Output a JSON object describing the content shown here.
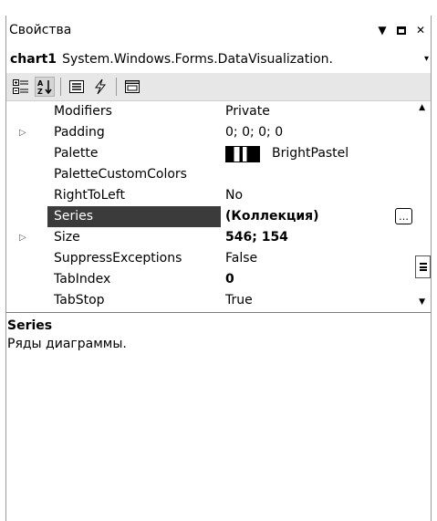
{
  "window": {
    "title": "Свойства",
    "controls": {
      "dropdown": "▼",
      "close": "✕"
    }
  },
  "selector": {
    "object_name": "chart1",
    "object_type": "System.Windows.Forms.DataVisualization.",
    "dropdown_glyph": "▾"
  },
  "toolbar": {
    "buttons": [
      {
        "name": "categorized-icon"
      },
      {
        "name": "alphabetical-icon"
      },
      {
        "name": "properties-icon"
      },
      {
        "name": "events-icon"
      },
      {
        "name": "property-pages-icon"
      }
    ]
  },
  "grid": {
    "rows": [
      {
        "name": "Modifiers",
        "value": "Private",
        "expander": ""
      },
      {
        "name": "Padding",
        "value": "0; 0; 0; 0",
        "expander": "▷"
      },
      {
        "name": "Palette",
        "value": "BrightPastel",
        "expander": ""
      },
      {
        "name": "PaletteCustomColors",
        "value": "",
        "expander": ""
      },
      {
        "name": "RightToLeft",
        "value": "No",
        "expander": ""
      },
      {
        "name": "Series",
        "value": "(Коллекция)",
        "expander": "",
        "selected": true,
        "ellipsis": "…"
      },
      {
        "name": "Size",
        "value": "546; 154",
        "expander": "▷"
      },
      {
        "name": "SuppressExceptions",
        "value": "False",
        "expander": ""
      },
      {
        "name": "TabIndex",
        "value": "0",
        "expander": ""
      },
      {
        "name": "TabStop",
        "value": "True",
        "expander": ""
      }
    ],
    "scroll": {
      "up": "▲",
      "down": "▼"
    }
  },
  "description": {
    "title": "Series",
    "text": "Ряды диаграммы."
  }
}
